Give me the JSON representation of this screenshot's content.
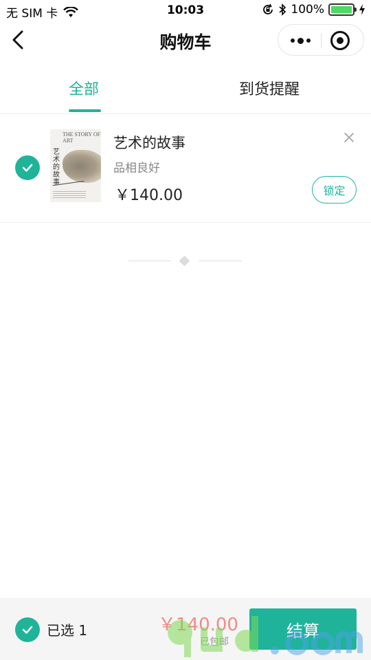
{
  "status_bar": {
    "carrier": "无 SIM 卡",
    "time": "10:03",
    "battery_percent": "100%",
    "icons": [
      "wifi-icon",
      "orientation-lock-icon",
      "bluetooth-icon",
      "battery-icon",
      "charging-icon"
    ]
  },
  "nav": {
    "title": "购物车",
    "back_icon": "chevron-left-icon",
    "more_icon": "more-dots-icon",
    "close_icon": "target-icon"
  },
  "tabs": [
    {
      "label": "全部",
      "active": true
    },
    {
      "label": "到货提醒",
      "active": false
    }
  ],
  "cart_items": [
    {
      "title": "艺术的故事",
      "condition": "品相良好",
      "price": "￥140.00",
      "action_label": "锁定",
      "checked": true,
      "cover": {
        "title_en": "THE STORY OF ART",
        "title_cn": "艺术的故事"
      }
    }
  ],
  "footer": {
    "selected_label": "已选 1",
    "total_price": "￥140.00",
    "shipping_note": "已包邮",
    "checkout_label": "结算"
  },
  "colors": {
    "accent": "#1fb39a",
    "price_highlight": "#f08b86",
    "battery": "#4cd964"
  }
}
